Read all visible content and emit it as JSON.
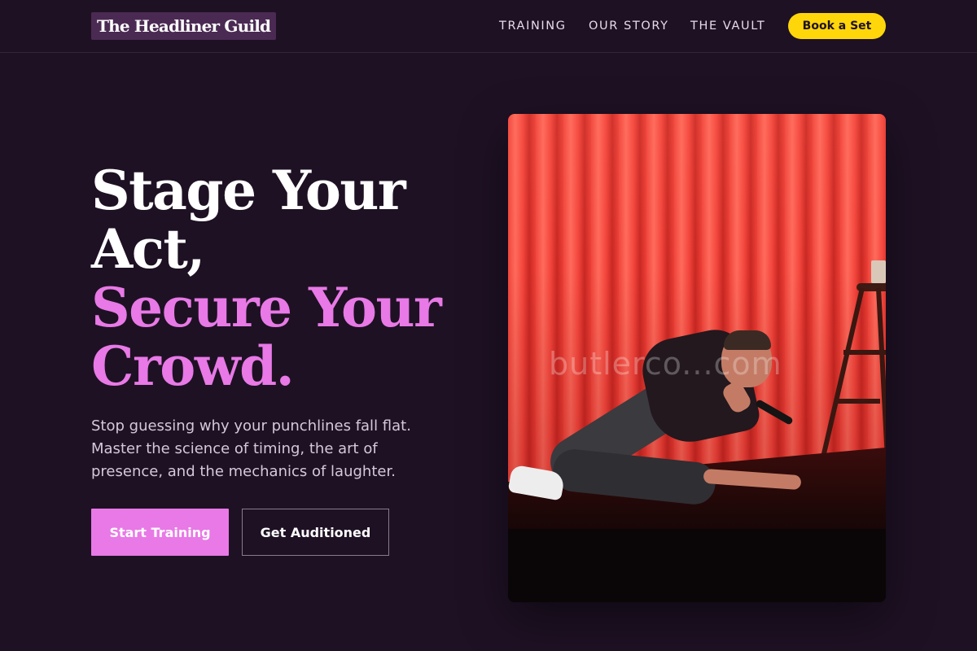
{
  "nav": {
    "logo": "The Headliner Guild",
    "links": [
      "TRAINING",
      "OUR STORY",
      "THE VAULT"
    ],
    "cta": "Book a Set"
  },
  "hero": {
    "title_lines": [
      "Stage Your",
      "Act,"
    ],
    "title_accent_lines": [
      "Secure Your",
      "Crowd."
    ],
    "subtitle": "Stop guessing why your punchlines fall flat. Master the science of timing, the art of presence, and the mechanics of laughter.",
    "primary_button": "Start Training",
    "secondary_button": "Get Auditioned",
    "image_watermark": "butlerco...com"
  },
  "colors": {
    "background": "#1e1124",
    "accent_pink": "#e879e6",
    "cta_yellow": "#ffd60a",
    "logo_bg": "#4a2a52"
  }
}
